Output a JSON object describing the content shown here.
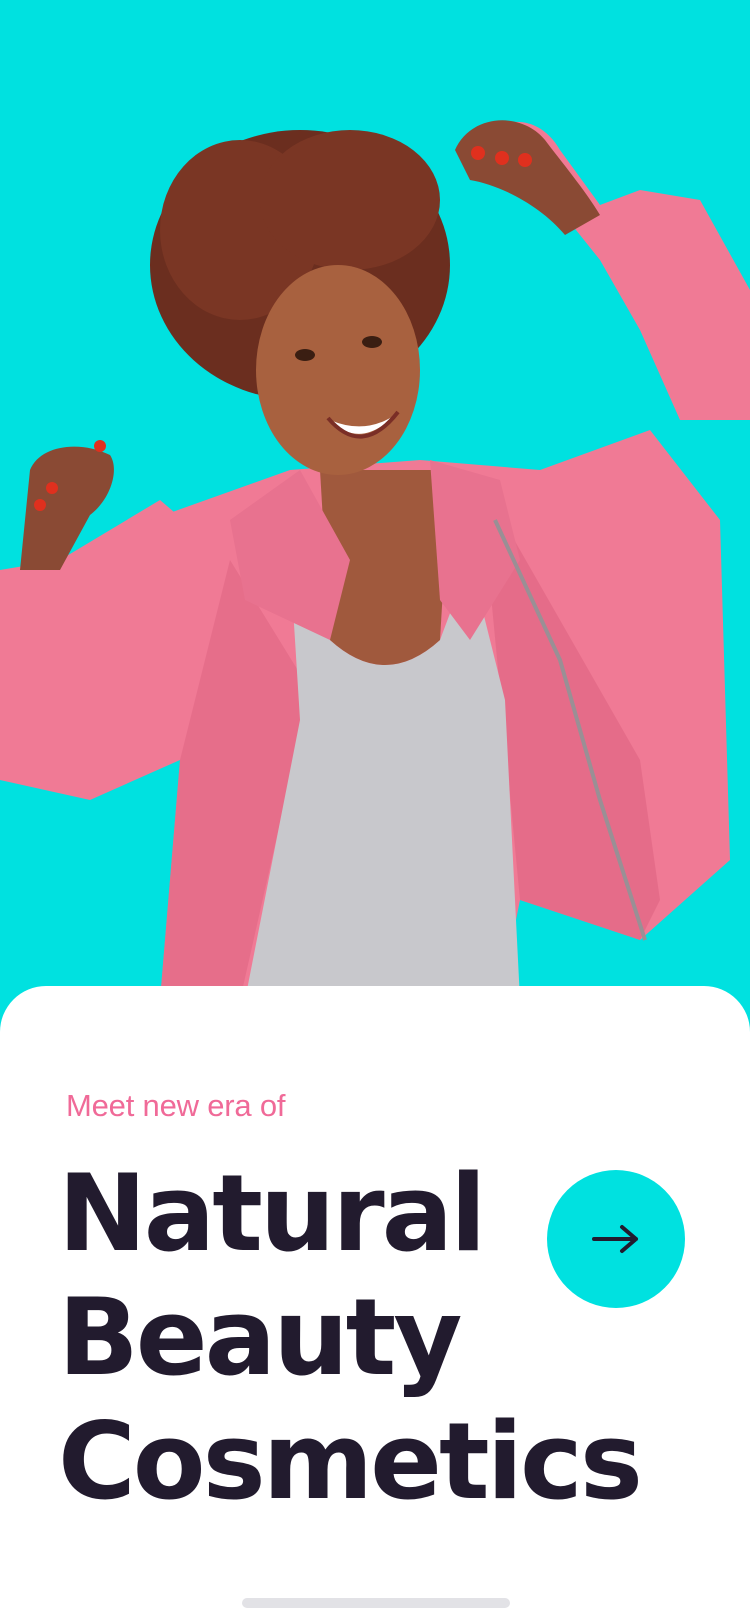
{
  "hero": {
    "image_alt": "Smiling woman in pink jacket dancing with arms raised"
  },
  "onboarding": {
    "eyebrow": "Meet new era of",
    "headline_lines": [
      "Natural",
      "Beauty",
      "Cosmetics"
    ],
    "next_icon": "arrow-right-icon"
  },
  "colors": {
    "accent": "#00E1E0",
    "eyebrow": "#F06A98",
    "headline": "#221B2E",
    "jacket": "#F07A95",
    "card": "#FFFFFF"
  }
}
